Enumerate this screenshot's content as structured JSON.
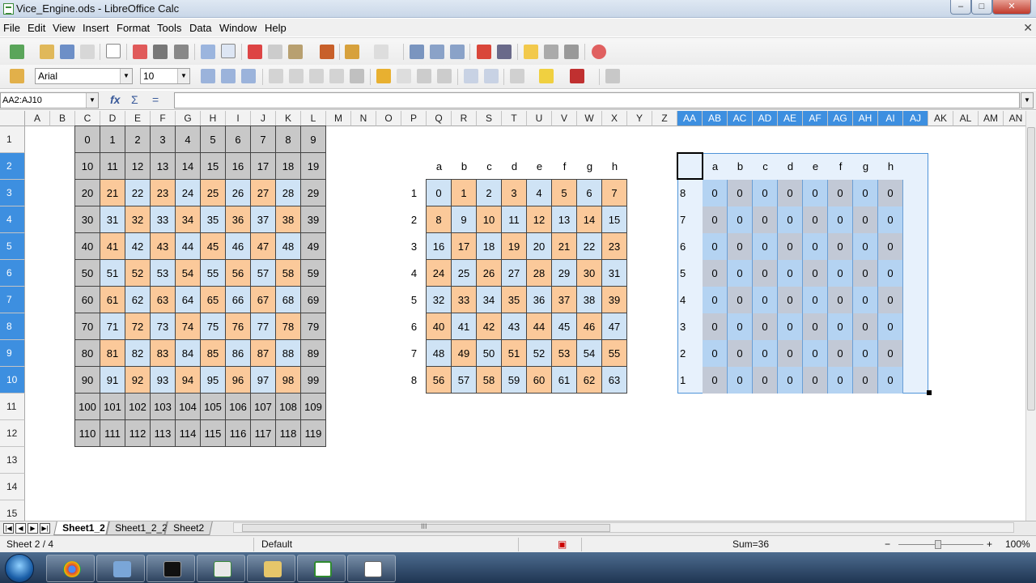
{
  "window": {
    "title": "Vice_Engine.ods - LibreOffice Calc",
    "controls": [
      "–",
      "□",
      "✕"
    ]
  },
  "menu": [
    "File",
    "Edit",
    "View",
    "Insert",
    "Format",
    "Tools",
    "Data",
    "Window",
    "Help"
  ],
  "toolbar": {
    "font_name": "Arial",
    "font_size": "10",
    "icons_standard": [
      "new-icon",
      "open-icon",
      "save-icon",
      "email-icon",
      "edit-file-icon",
      "export-pdf-icon",
      "print-icon",
      "print-preview-icon",
      "spellcheck-icon",
      "autospellcheck-icon",
      "cut-icon",
      "copy-icon",
      "paste-icon",
      "clone-format-icon",
      "undo-icon",
      "redo-icon",
      "hyperlink-icon",
      "sort-ascending-icon",
      "sort-descending-icon",
      "chart-icon",
      "pivot-icon",
      "navigator-icon",
      "gallery-icon",
      "datasources-icon",
      "help-icon"
    ],
    "icons_format": [
      "bold-icon",
      "italic-icon",
      "underline-icon",
      "align-left-icon",
      "align-center-icon",
      "align-right-icon",
      "justify-icon",
      "merge-cells-icon",
      "currency-icon",
      "percent-icon",
      "number-format-icon",
      "add-decimal-icon",
      "delete-decimal-icon",
      "decrease-indent-icon",
      "increase-indent-icon",
      "borders-icon",
      "background-color-icon",
      "font-color-icon",
      "toggle-grid-icon"
    ]
  },
  "formula_bar": {
    "name_box": "AA2:AJ10",
    "function_wizard": "fx",
    "sum": "Σ",
    "equals": "=",
    "content": ""
  },
  "columns": [
    "A",
    "B",
    "C",
    "D",
    "E",
    "F",
    "G",
    "H",
    "I",
    "J",
    "K",
    "L",
    "M",
    "N",
    "O",
    "P",
    "Q",
    "R",
    "S",
    "T",
    "U",
    "V",
    "W",
    "X",
    "Y",
    "Z",
    "AA",
    "AB",
    "AC",
    "AD",
    "AE",
    "AF",
    "AG",
    "AH",
    "AI",
    "AJ",
    "AK",
    "AL",
    "AM",
    "AN"
  ],
  "rows": [
    "1",
    "2",
    "3",
    "4",
    "5",
    "6",
    "7",
    "8",
    "9",
    "10",
    "11",
    "12",
    "13",
    "14",
    "15"
  ],
  "grid1": [
    [
      "0",
      "1",
      "2",
      "3",
      "4",
      "5",
      "6",
      "7",
      "8",
      "9"
    ],
    [
      "10",
      "11",
      "12",
      "13",
      "14",
      "15",
      "16",
      "17",
      "18",
      "19"
    ],
    [
      "20",
      "21",
      "22",
      "23",
      "24",
      "25",
      "26",
      "27",
      "28",
      "29"
    ],
    [
      "30",
      "31",
      "32",
      "33",
      "34",
      "35",
      "36",
      "37",
      "38",
      "39"
    ],
    [
      "40",
      "41",
      "42",
      "43",
      "44",
      "45",
      "46",
      "47",
      "48",
      "49"
    ],
    [
      "50",
      "51",
      "52",
      "53",
      "54",
      "55",
      "56",
      "57",
      "58",
      "59"
    ],
    [
      "60",
      "61",
      "62",
      "63",
      "64",
      "65",
      "66",
      "67",
      "68",
      "69"
    ],
    [
      "70",
      "71",
      "72",
      "73",
      "74",
      "75",
      "76",
      "77",
      "78",
      "79"
    ],
    [
      "80",
      "81",
      "82",
      "83",
      "84",
      "85",
      "86",
      "87",
      "88",
      "89"
    ],
    [
      "90",
      "91",
      "92",
      "93",
      "94",
      "95",
      "96",
      "97",
      "98",
      "99"
    ],
    [
      "100",
      "101",
      "102",
      "103",
      "104",
      "105",
      "106",
      "107",
      "108",
      "109"
    ],
    [
      "110",
      "111",
      "112",
      "113",
      "114",
      "115",
      "116",
      "117",
      "118",
      "119"
    ]
  ],
  "board2": {
    "files": [
      "a",
      "b",
      "c",
      "d",
      "e",
      "f",
      "g",
      "h"
    ],
    "ranks": [
      "1",
      "2",
      "3",
      "4",
      "5",
      "6",
      "7",
      "8"
    ],
    "values": [
      [
        "0",
        "1",
        "2",
        "3",
        "4",
        "5",
        "6",
        "7"
      ],
      [
        "8",
        "9",
        "10",
        "11",
        "12",
        "13",
        "14",
        "15"
      ],
      [
        "16",
        "17",
        "18",
        "19",
        "20",
        "21",
        "22",
        "23"
      ],
      [
        "24",
        "25",
        "26",
        "27",
        "28",
        "29",
        "30",
        "31"
      ],
      [
        "32",
        "33",
        "34",
        "35",
        "36",
        "37",
        "38",
        "39"
      ],
      [
        "40",
        "41",
        "42",
        "43",
        "44",
        "45",
        "46",
        "47"
      ],
      [
        "48",
        "49",
        "50",
        "51",
        "52",
        "53",
        "54",
        "55"
      ],
      [
        "56",
        "57",
        "58",
        "59",
        "60",
        "61",
        "62",
        "63"
      ]
    ]
  },
  "board3": {
    "files": [
      "a",
      "b",
      "c",
      "d",
      "e",
      "f",
      "g",
      "h"
    ],
    "ranks": [
      "8",
      "7",
      "6",
      "5",
      "4",
      "3",
      "2",
      "1"
    ],
    "values": [
      [
        "0",
        "0",
        "0",
        "0",
        "0",
        "0",
        "0",
        "0"
      ],
      [
        "0",
        "0",
        "0",
        "0",
        "0",
        "0",
        "0",
        "0"
      ],
      [
        "0",
        "0",
        "0",
        "0",
        "0",
        "0",
        "0",
        "0"
      ],
      [
        "0",
        "0",
        "0",
        "0",
        "0",
        "0",
        "0",
        "0"
      ],
      [
        "0",
        "0",
        "0",
        "0",
        "0",
        "0",
        "0",
        "0"
      ],
      [
        "0",
        "0",
        "0",
        "0",
        "0",
        "0",
        "0",
        "0"
      ],
      [
        "0",
        "0",
        "0",
        "0",
        "0",
        "0",
        "0",
        "0"
      ],
      [
        "0",
        "0",
        "0",
        "0",
        "0",
        "0",
        "0",
        "0"
      ]
    ]
  },
  "sheet_tabs": [
    "Sheet1_2",
    "Sheet1_2_2",
    "Sheet2"
  ],
  "active_tab": "Sheet1_2",
  "hscroll_mark": "III",
  "status": {
    "sheet": "Sheet 2 / 4",
    "style": "Default",
    "sum": "Sum=36",
    "zoom": "100%"
  },
  "colors": {
    "selection": "#3d8fe0",
    "gray_cell": "#c8c8c8",
    "orange_cell": "#fbc99a",
    "blue_cell": "#cfe3f5"
  },
  "taskbar": [
    "start-orb-icon",
    "chrome-icon",
    "control-panel-icon",
    "cmd-icon",
    "calc-task-icon",
    "explorer-icon",
    "spreadsheet-icon",
    "libreoffice-icon"
  ]
}
